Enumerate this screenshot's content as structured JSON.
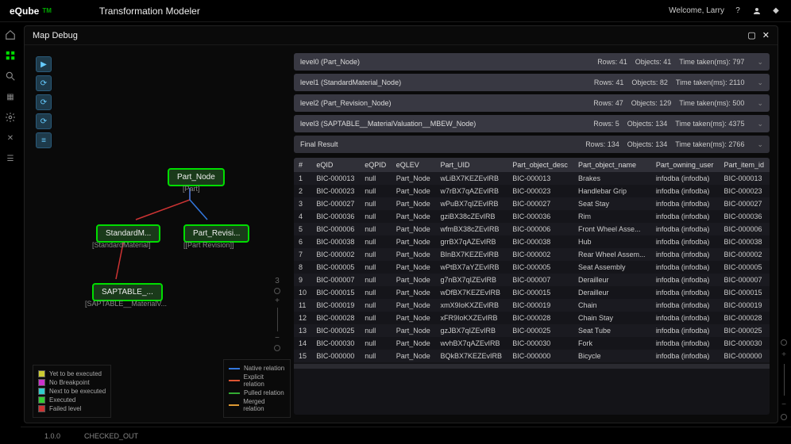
{
  "brand": {
    "name": "eQube",
    "sub": "TM"
  },
  "app_title": "Transformation Modeler",
  "welcome": "Welcome, Larry",
  "panel_title": "Map Debug",
  "graph": {
    "nodes": {
      "root": {
        "label": "Part_Node",
        "sub": "[Part]"
      },
      "std": {
        "label": "StandardM...",
        "sub": "[StandardMaterial]"
      },
      "rev": {
        "label": "Part_Revisi...",
        "sub": "[[Part Revision]]"
      },
      "sap": {
        "label": "SAPTABLE_...",
        "sub": "[SAPTABLE__MaterialV..."
      }
    }
  },
  "legend_exec": [
    {
      "color": "#cccc33",
      "label": "Yet to be executed"
    },
    {
      "color": "#cc33cc",
      "label": "No Breakpoint"
    },
    {
      "color": "#33cccc",
      "label": "Next to be executed"
    },
    {
      "color": "#33cc33",
      "label": "Executed"
    },
    {
      "color": "#cc3333",
      "label": "Failed level"
    }
  ],
  "legend_rel": [
    {
      "color": "#3377dd",
      "label": "Native relation"
    },
    {
      "color": "#dd5533",
      "label": "Explicit relation"
    },
    {
      "color": "#33aa33",
      "label": "Pulled relation"
    },
    {
      "color": "#dd9933",
      "label": "Merged relation"
    }
  ],
  "levels": [
    {
      "name": "level0 (Part_Node)",
      "rows": "Rows: 41",
      "objects": "Objects: 41",
      "time": "Time taken(ms): 797"
    },
    {
      "name": "level1 (StandardMaterial_Node)",
      "rows": "Rows: 41",
      "objects": "Objects: 82",
      "time": "Time taken(ms): 2110"
    },
    {
      "name": "level2 (Part_Revision_Node)",
      "rows": "Rows: 47",
      "objects": "Objects: 129",
      "time": "Time taken(ms): 500"
    },
    {
      "name": "level3 (SAPTABLE__MaterialValuation__MBEW_Node)",
      "rows": "Rows: 5",
      "objects": "Objects: 134",
      "time": "Time taken(ms): 4375"
    }
  ],
  "final": {
    "name": "Final Result",
    "rows": "Rows: 134",
    "objects": "Objects: 134",
    "time": "Time taken(ms): 2766"
  },
  "columns": [
    "#",
    "eQID",
    "eQPID",
    "eQLEV",
    "Part_UID",
    "Part_object_desc",
    "Part_object_name",
    "Part_owning_user",
    "Part_item_id"
  ],
  "rows": [
    [
      "1",
      "BIC-000013",
      "null",
      "Part_Node",
      "wLiBX7KEZEvIRB",
      "BIC-000013",
      "Brakes",
      "infodba (infodba)",
      "BIC-000013"
    ],
    [
      "2",
      "BIC-000023",
      "null",
      "Part_Node",
      "w7rBX7qAZEvIRB",
      "BIC-000023",
      "Handlebar Grip",
      "infodba (infodba)",
      "BIC-000023"
    ],
    [
      "3",
      "BIC-000027",
      "null",
      "Part_Node",
      "wPuBX7qIZEvIRB",
      "BIC-000027",
      "Seat Stay",
      "infodba (infodba)",
      "BIC-000027"
    ],
    [
      "4",
      "BIC-000036",
      "null",
      "Part_Node",
      "gziBX38cZEvIRB",
      "BIC-000036",
      "Rim",
      "infodba (infodba)",
      "BIC-000036"
    ],
    [
      "5",
      "BIC-000006",
      "null",
      "Part_Node",
      "wfmBX38cZEvIRB",
      "BIC-000006",
      "Front Wheel Asse...",
      "infodba (infodba)",
      "BIC-000006"
    ],
    [
      "6",
      "BIC-000038",
      "null",
      "Part_Node",
      "grrBX7qAZEvIRB",
      "BIC-000038",
      "Hub",
      "infodba (infodba)",
      "BIC-000038"
    ],
    [
      "7",
      "BIC-000002",
      "null",
      "Part_Node",
      "BInBX7KEZEvIRB",
      "BIC-000002",
      "Rear Wheel Assem...",
      "infodba (infodba)",
      "BIC-000002"
    ],
    [
      "8",
      "BIC-000005",
      "null",
      "Part_Node",
      "wPtBX7aYZEvIRB",
      "BIC-000005",
      "Seat Assembly",
      "infodba (infodba)",
      "BIC-000005"
    ],
    [
      "9",
      "BIC-000007",
      "null",
      "Part_Node",
      "g7nBX7qIZEvIRB",
      "BIC-000007",
      "Derailleur",
      "infodba (infodba)",
      "BIC-000007"
    ],
    [
      "10",
      "BIC-000015",
      "null",
      "Part_Node",
      "wDfBX7KEZEvIRB",
      "BIC-000015",
      "Derailleur",
      "infodba (infodba)",
      "BIC-000015"
    ],
    [
      "11",
      "BIC-000019",
      "null",
      "Part_Node",
      "xmX9IoKXZEvIRB",
      "BIC-000019",
      "Chain",
      "infodba (infodba)",
      "BIC-000019"
    ],
    [
      "12",
      "BIC-000028",
      "null",
      "Part_Node",
      "xFR9IoKXZEvIRB",
      "BIC-000028",
      "Chain Stay",
      "infodba (infodba)",
      "BIC-000028"
    ],
    [
      "13",
      "BIC-000025",
      "null",
      "Part_Node",
      "gzJBX7qIZEvIRB",
      "BIC-000025",
      "Seat Tube",
      "infodba (infodba)",
      "BIC-000025"
    ],
    [
      "14",
      "BIC-000030",
      "null",
      "Part_Node",
      "wvhBX7qAZEvIRB",
      "BIC-000030",
      "Fork",
      "infodba (infodba)",
      "BIC-000030"
    ],
    [
      "15",
      "BIC-000000",
      "null",
      "Part_Node",
      "BQkBX7KEZEvIRB",
      "BIC-000000",
      "Bicycle",
      "infodba (infodba)",
      "BIC-000000"
    ]
  ],
  "footer": {
    "version": "1.0.0",
    "status": "CHECKED_OUT"
  }
}
